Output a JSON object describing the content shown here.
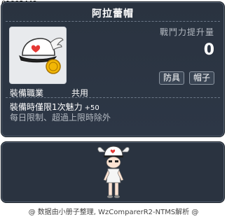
{
  "item_id": "01002449",
  "item": {
    "name": "阿拉蕾帽",
    "icon": "winged-cap-icon"
  },
  "stats": {
    "label": "戰鬥力提升量",
    "value": "0"
  },
  "tags": {
    "type": "防具",
    "subtype": "帽子"
  },
  "job": {
    "label": "裝備職業",
    "value": "共用"
  },
  "effect": {
    "text": "裝備時僅限1次魅力",
    "value": "+50"
  },
  "note": "每日限制、超過上限時除外",
  "avatar": {
    "icon": "character-preview-icon"
  },
  "footer": "@ 数据由小册子整理, WzComparerR2-NTMS解析 @",
  "colors": {
    "panel_bg": "#2a3340",
    "panel_border": "#111820",
    "text_primary": "#ffffff",
    "text_muted": "#b3b9c1"
  }
}
